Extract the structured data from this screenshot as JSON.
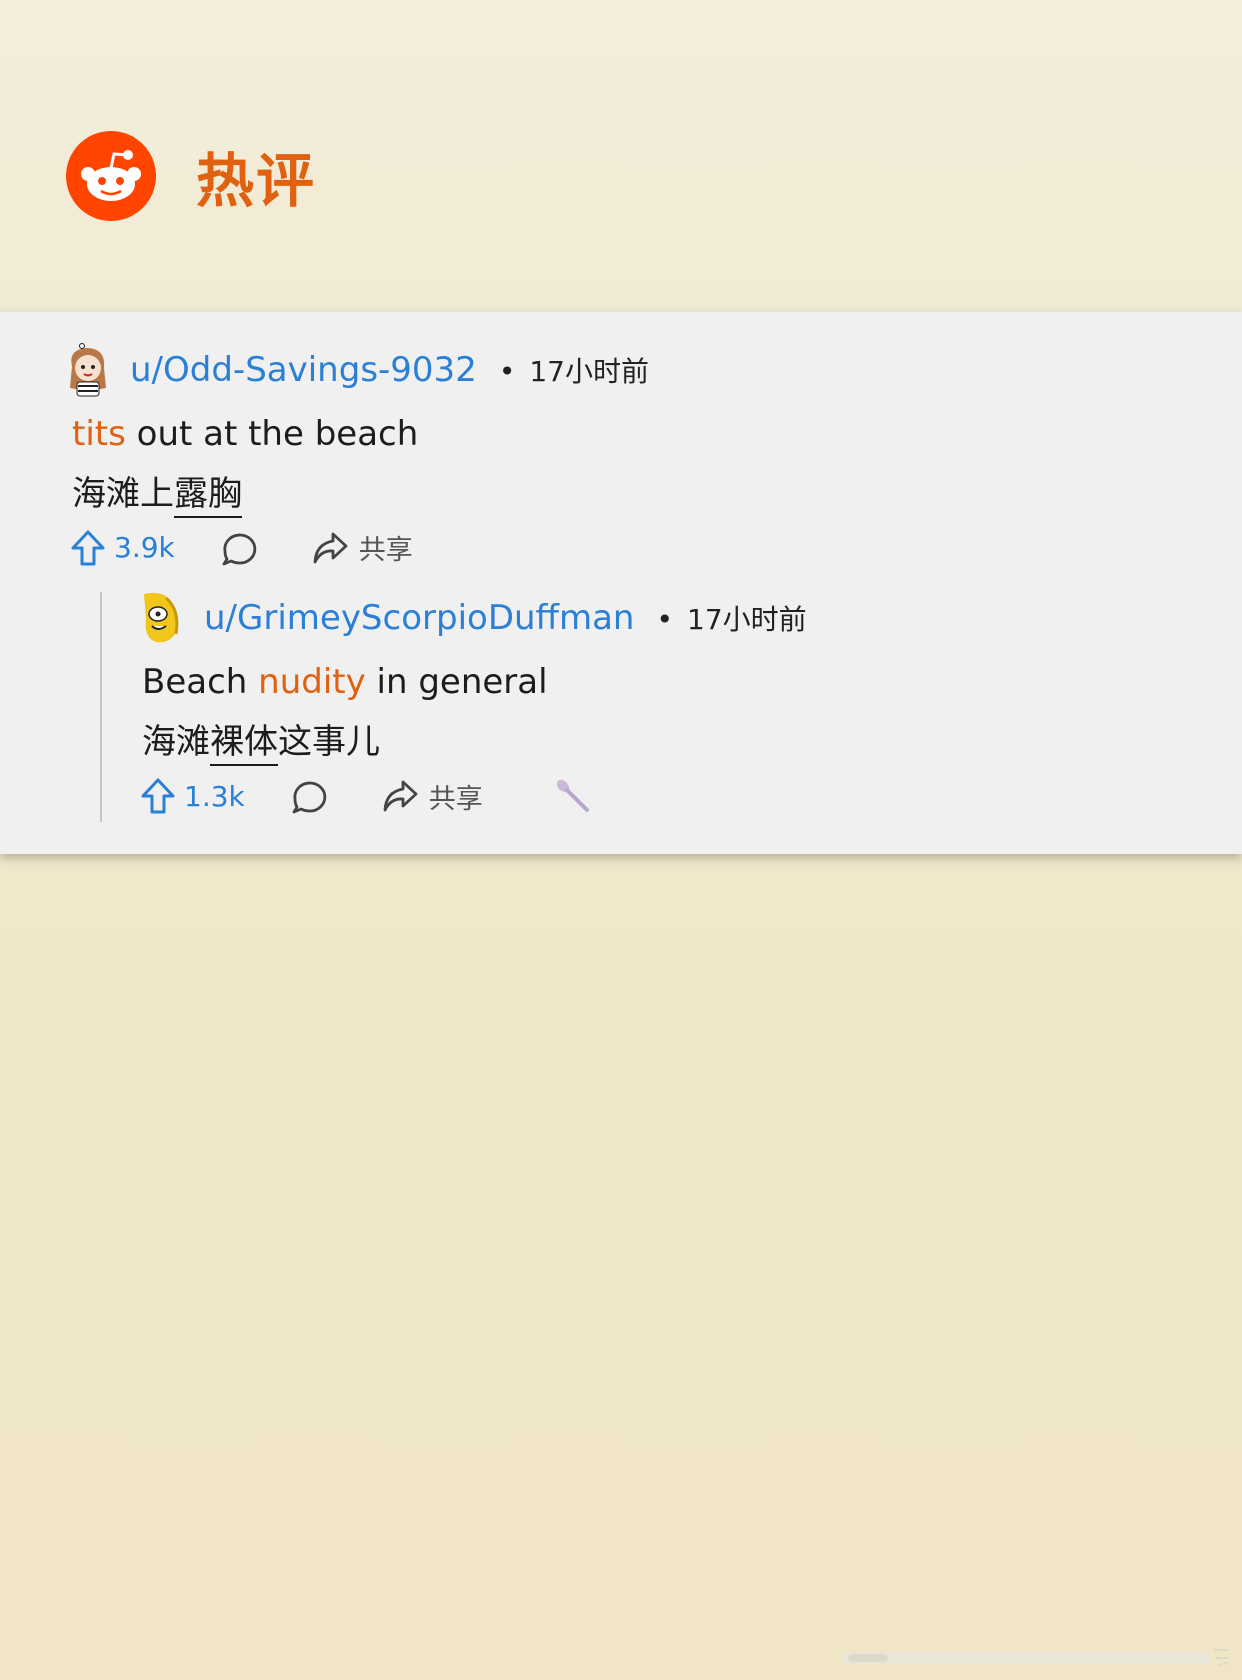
{
  "header": {
    "title": "热评",
    "logo_icon": "reddit-logo-icon",
    "brand_color": "#ff4500"
  },
  "comments": [
    {
      "username": "u/Odd-Savings-9032",
      "dot": "•",
      "time": "17小时前",
      "text_en": {
        "hl": "tits",
        "rest": " out at the beach"
      },
      "text_zh": {
        "before": "海滩上",
        "ul": "露胸",
        "after": ""
      },
      "upvotes": "3.9k",
      "share_label": "共享"
    },
    {
      "username": "u/GrimeyScorpioDuffman",
      "dot": "•",
      "time": "17小时前",
      "text_en": {
        "before": "Beach ",
        "hl": "nudity",
        "after": " in general"
      },
      "text_zh": {
        "before": "海滩",
        "ul": "裸体",
        "after": "这事儿"
      },
      "upvotes": "1.3k",
      "share_label": "共享"
    }
  ],
  "colors": {
    "accent": "#e0610f",
    "link": "#2a7fd6",
    "card": "#f0f0f0"
  }
}
